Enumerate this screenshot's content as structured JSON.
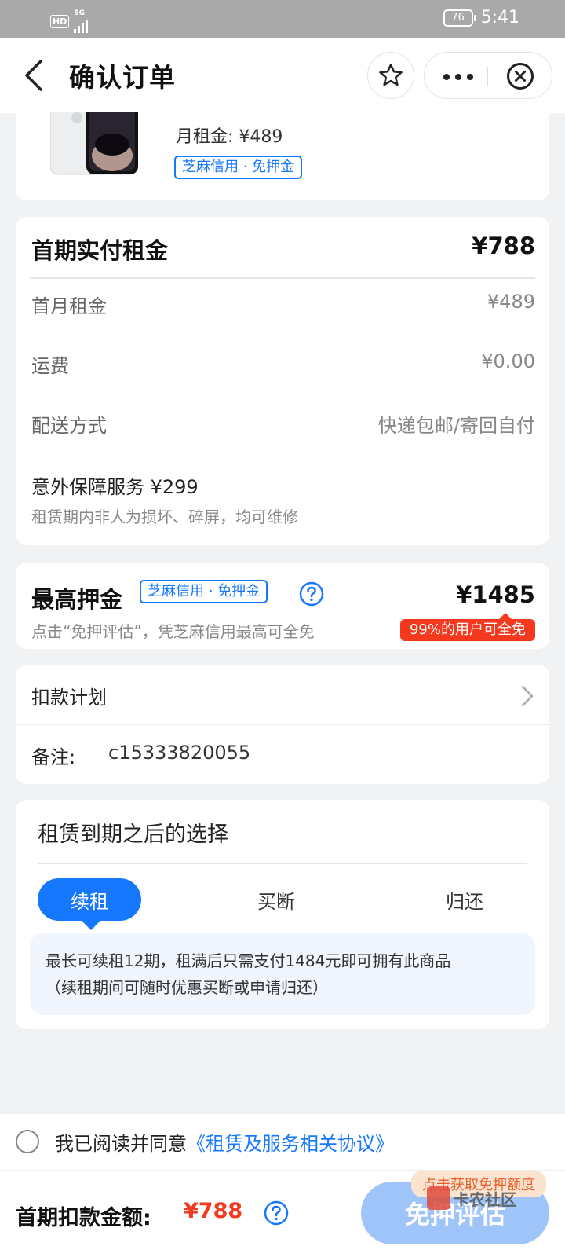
{
  "status_bar": {
    "hd": "HD",
    "network": "5G",
    "battery": "76",
    "time": "5:41"
  },
  "nav": {
    "title": "确认订单"
  },
  "product": {
    "monthly_rent_label": "月租金:",
    "monthly_rent": "¥489",
    "tag": "芝麻信用 · 免押金"
  },
  "first_payment": {
    "title": "首期实付租金",
    "total": "¥788",
    "rows": [
      {
        "label": "首月租金",
        "value": "¥489"
      },
      {
        "label": "运费",
        "value": "¥0.00"
      },
      {
        "label": "配送方式",
        "value": "快递包邮/寄回自付"
      }
    ],
    "insurance_title": "意外保障服务 ¥299",
    "insurance_desc": "租赁期内非人为损坏、碎屏，均可维修"
  },
  "deposit": {
    "title": "最高押金",
    "tag": "芝麻信用 · 免押金",
    "amount": "¥1485",
    "desc": "点击“免押评估”，凭芝麻信用最高可全免",
    "badge": "99%的用户可全免"
  },
  "plan": {
    "label": "扣款计划",
    "note_label": "备注:",
    "note_value": "c15333820055"
  },
  "after_lease": {
    "title": "租赁到期之后的选择",
    "tabs": [
      "续租",
      "买断",
      "归还"
    ],
    "active_tab": 0,
    "desc_line1": "最长可续租12期，租满后只需支付1484元即可拥有此商品",
    "desc_line2": "（续租期间可随时优惠买断或申请归还）"
  },
  "agreement": {
    "text": "我已阅读并同意",
    "link": "《租赁及服务相关协议》"
  },
  "footer": {
    "label": "首期扣款金额:",
    "amount": "¥788",
    "button": "免押评估",
    "bubble": "点击获取免押额度",
    "watermark": "卡农社区"
  },
  "colors": {
    "accent": "#1677ff",
    "price_red": "#f5391e",
    "button_disabled": "#9fc4fa"
  }
}
